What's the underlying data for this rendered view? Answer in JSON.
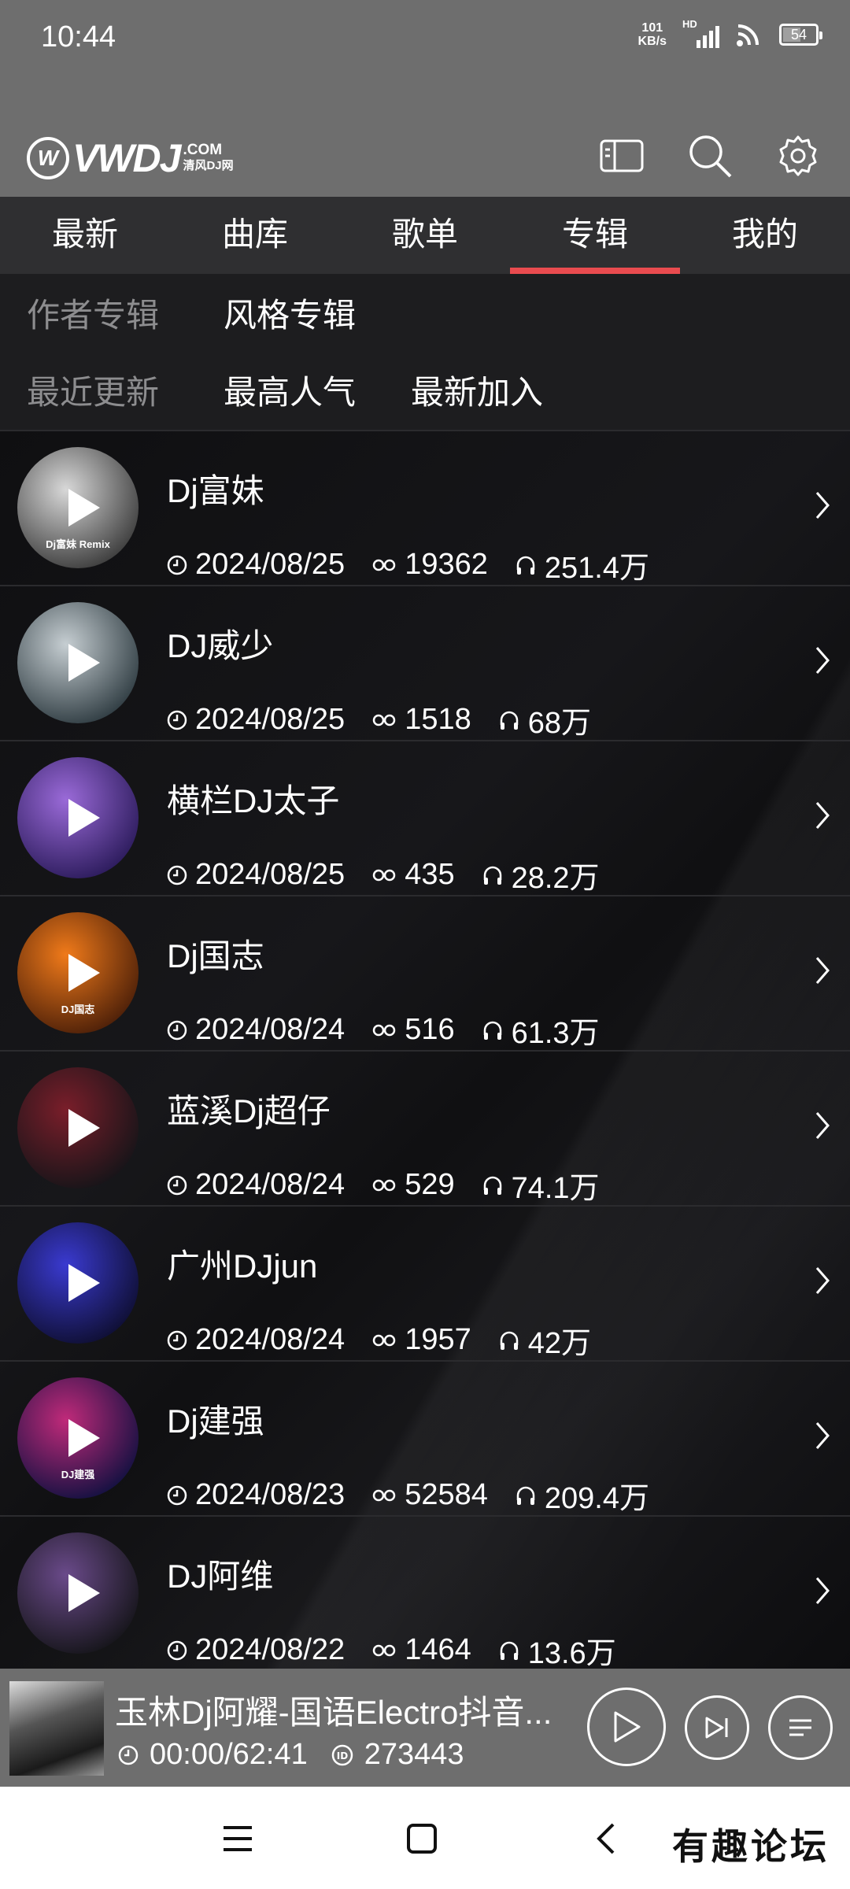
{
  "status_bar": {
    "time": "10:44",
    "net_speed_value": "101",
    "net_speed_unit": "KB/s",
    "hd_label": "HD",
    "battery": "54"
  },
  "header": {
    "logo_brand": "VWDJ",
    "logo_domain": ".COM",
    "logo_sub": "清风DJ网",
    "icons": [
      "tablet-icon",
      "search-icon",
      "gear-icon"
    ]
  },
  "tabs": [
    {
      "label": "最新",
      "active": false
    },
    {
      "label": "曲库",
      "active": false
    },
    {
      "label": "歌单",
      "active": false
    },
    {
      "label": "专辑",
      "active": true
    },
    {
      "label": "我的",
      "active": false
    }
  ],
  "filters": {
    "category": {
      "label": "作者专辑",
      "options": [
        "风格专辑"
      ]
    },
    "sort": {
      "label": "最近更新",
      "options": [
        "最高人气",
        "最新加入"
      ]
    }
  },
  "albums": [
    {
      "title": "Dj富妹",
      "date": "2024/08/25",
      "links": "19362",
      "plays": "251.4万",
      "cover_text": "Dj富妹 Remix",
      "colors": [
        "#d8d8d8",
        "#3a3a3a"
      ]
    },
    {
      "title": "DJ威少",
      "date": "2024/08/25",
      "links": "1518",
      "plays": "68万",
      "cover_text": "",
      "colors": [
        "#c6ced2",
        "#2d3a40"
      ]
    },
    {
      "title": "横栏DJ太子",
      "date": "2024/08/25",
      "links": "435",
      "plays": "28.2万",
      "cover_text": "",
      "colors": [
        "#9a6ad8",
        "#2a1a5a"
      ]
    },
    {
      "title": "Dj国志",
      "date": "2024/08/24",
      "links": "516",
      "plays": "61.3万",
      "cover_text": "DJ国志",
      "colors": [
        "#f07a1a",
        "#4a1e08"
      ]
    },
    {
      "title": "蓝溪Dj超仔",
      "date": "2024/08/24",
      "links": "529",
      "plays": "74.1万",
      "cover_text": "",
      "colors": [
        "#7a1e2a",
        "#141418"
      ]
    },
    {
      "title": "广州DJjun",
      "date": "2024/08/24",
      "links": "1957",
      "plays": "42万",
      "cover_text": "",
      "colors": [
        "#3a3ad0",
        "#0e0e30"
      ]
    },
    {
      "title": "Dj建强",
      "date": "2024/08/23",
      "links": "52584",
      "plays": "209.4万",
      "cover_text": "DJ建强",
      "colors": [
        "#c02a7a",
        "#101040"
      ]
    },
    {
      "title": "DJ阿维",
      "date": "2024/08/22",
      "links": "1464",
      "plays": "13.6万",
      "cover_text": "",
      "colors": [
        "#6a4a8a",
        "#141418"
      ]
    }
  ],
  "player": {
    "song_title": "玉林Dj阿耀-国语Electro抖音...",
    "time": "00:00/62:41",
    "id": "273443"
  },
  "watermark": "有趣论坛"
}
